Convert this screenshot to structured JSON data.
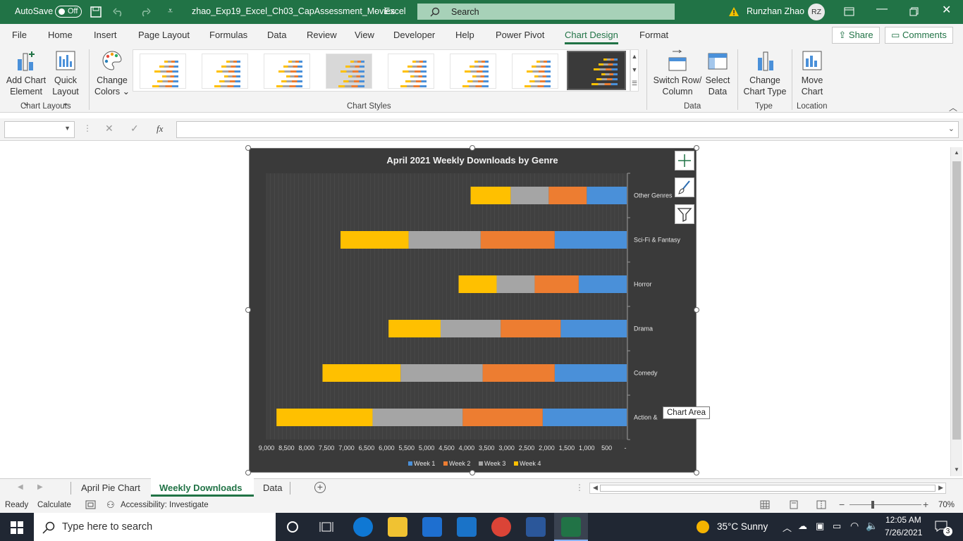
{
  "titlebar": {
    "autosave": "AutoSave",
    "autosave_state": "Off",
    "filename": "zhao_Exp19_Excel_Ch03_CapAssessment_Movies",
    "separator": "-",
    "app": "Excel",
    "search_placeholder": "Search",
    "user_name": "Runzhan Zhao",
    "user_initials": "RZ"
  },
  "tabs": [
    "File",
    "Home",
    "Insert",
    "Page Layout",
    "Formulas",
    "Data",
    "Review",
    "View",
    "Developer",
    "Help",
    "Power Pivot",
    "Chart Design",
    "Format"
  ],
  "active_tab": "Chart Design",
  "share_label": "Share",
  "comments_label": "Comments",
  "ribbon": {
    "add_chart_element": [
      "Add Chart",
      "Element"
    ],
    "quick_layout": [
      "Quick",
      "Layout"
    ],
    "change_colors": [
      "Change",
      "Colors"
    ],
    "switch_row_column": [
      "Switch Row/",
      "Column"
    ],
    "select_data": [
      "Select",
      "Data"
    ],
    "change_chart_type": [
      "Change",
      "Chart Type"
    ],
    "move_chart": [
      "Move",
      "Chart"
    ],
    "groups": {
      "chart_layouts": "Chart Layouts",
      "chart_styles": "Chart Styles",
      "data": "Data",
      "type": "Type",
      "location": "Location"
    }
  },
  "formula": {
    "fx": "fx",
    "name_box": "",
    "value": ""
  },
  "chart_data": {
    "type": "bar",
    "title": "April 2021 Weekly Downloads by Genre",
    "categories": [
      "Action & Adventure",
      "Comedy",
      "Drama",
      "Horror",
      "Sci-Fi & Fantasy",
      "Other Genres"
    ],
    "category_labels": [
      "Action &",
      "Comedy",
      "Drama",
      "Horror",
      "Sci-Fi & Fantasy",
      "Other Genres"
    ],
    "stacked": true,
    "x_reversed": true,
    "xlim": [
      0,
      9000
    ],
    "x_ticks": [
      "9,000",
      "8,500",
      "8,000",
      "7,500",
      "7,000",
      "6,500",
      "6,000",
      "5,500",
      "5,000",
      "4,500",
      "4,000",
      "3,500",
      "3,000",
      "2,500",
      "2,000",
      "1,500",
      "1,000",
      "500",
      "-"
    ],
    "series": [
      {
        "name": "Week 1",
        "color": "#4a90d9",
        "values": [
          2100,
          1800,
          1650,
          1200,
          1800,
          1000
        ]
      },
      {
        "name": "Week 2",
        "color": "#ed7d31",
        "values": [
          2000,
          1800,
          1500,
          1100,
          1850,
          950
        ]
      },
      {
        "name": "Week 3",
        "color": "#a5a5a5",
        "values": [
          2250,
          2050,
          1500,
          950,
          1800,
          950
        ]
      },
      {
        "name": "Week 4",
        "color": "#ffc000",
        "values": [
          2400,
          1950,
          1300,
          950,
          1700,
          1000
        ]
      }
    ],
    "legend": "bottom",
    "grid": true
  },
  "tooltip": "Chart Area",
  "sheet_tabs": [
    "April Pie Chart",
    "Weekly Downloads",
    "Data"
  ],
  "active_sheet": "Weekly Downloads",
  "status": {
    "ready": "Ready",
    "calculate": "Calculate",
    "accessibility": "Accessibility: Investigate",
    "zoom": "70%"
  },
  "taskbar": {
    "search_placeholder": "Type here to search",
    "weather": "35°C  Sunny",
    "time": "12:05 AM",
    "date": "7/26/2021",
    "notifications": "3"
  }
}
